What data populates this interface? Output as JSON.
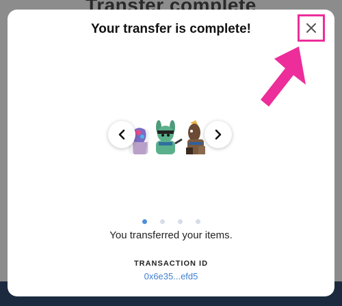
{
  "background": {
    "heading": "Transfer complete"
  },
  "modal": {
    "title": "Your transfer is complete!",
    "message": "You transferred your items.",
    "transaction_label": "TRANSACTION ID",
    "transaction_id": "0x6e35...efd5"
  },
  "carousel": {
    "pages": 4,
    "active_index": 0
  },
  "colors": {
    "annotation": "#ec2d9a",
    "link": "#3f7fd0",
    "active_dot": "#4e8fdc",
    "inactive_dot": "#d6dde8"
  },
  "icons": {
    "close": "close-icon",
    "prev": "chevron-left-icon",
    "next": "chevron-right-icon",
    "annotation": "arrow-up-right-icon"
  }
}
